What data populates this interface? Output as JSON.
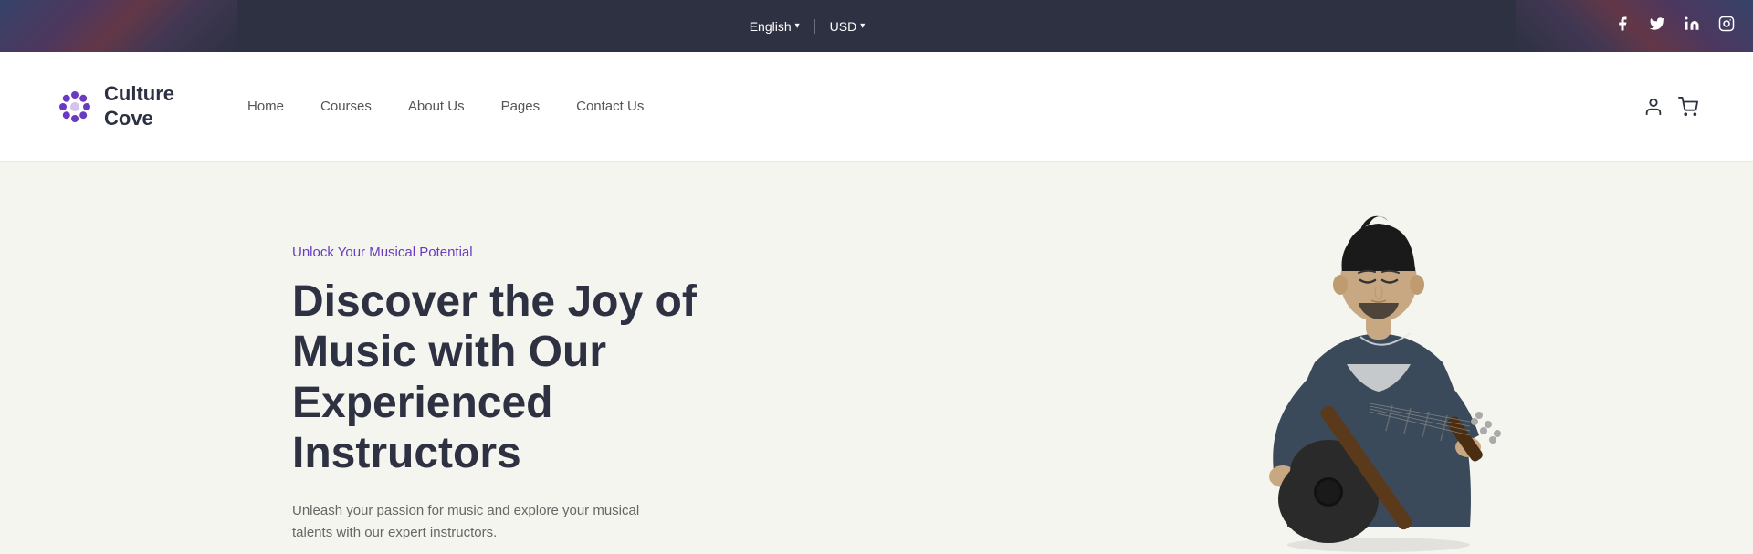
{
  "topbar": {
    "language": {
      "label": "English",
      "has_dropdown": true
    },
    "currency": {
      "label": "USD",
      "has_dropdown": true
    },
    "social": {
      "facebook_label": "Facebook",
      "twitter_label": "Twitter",
      "linkedin_label": "LinkedIn",
      "instagram_label": "Instagram"
    }
  },
  "logo": {
    "name_line1": "Culture",
    "name_line2": "Cove"
  },
  "nav": {
    "items": [
      {
        "label": "Home",
        "id": "home"
      },
      {
        "label": "Courses",
        "id": "courses"
      },
      {
        "label": "About Us",
        "id": "about-us"
      },
      {
        "label": "Pages",
        "id": "pages"
      },
      {
        "label": "Contact Us",
        "id": "contact-us"
      }
    ]
  },
  "hero": {
    "eyebrow": "Unlock Your Musical Potential",
    "title": "Discover the Joy of Music with Our Experienced Instructors",
    "subtitle": "Unleash your passion for music and explore your musical talents with our expert instructors."
  }
}
